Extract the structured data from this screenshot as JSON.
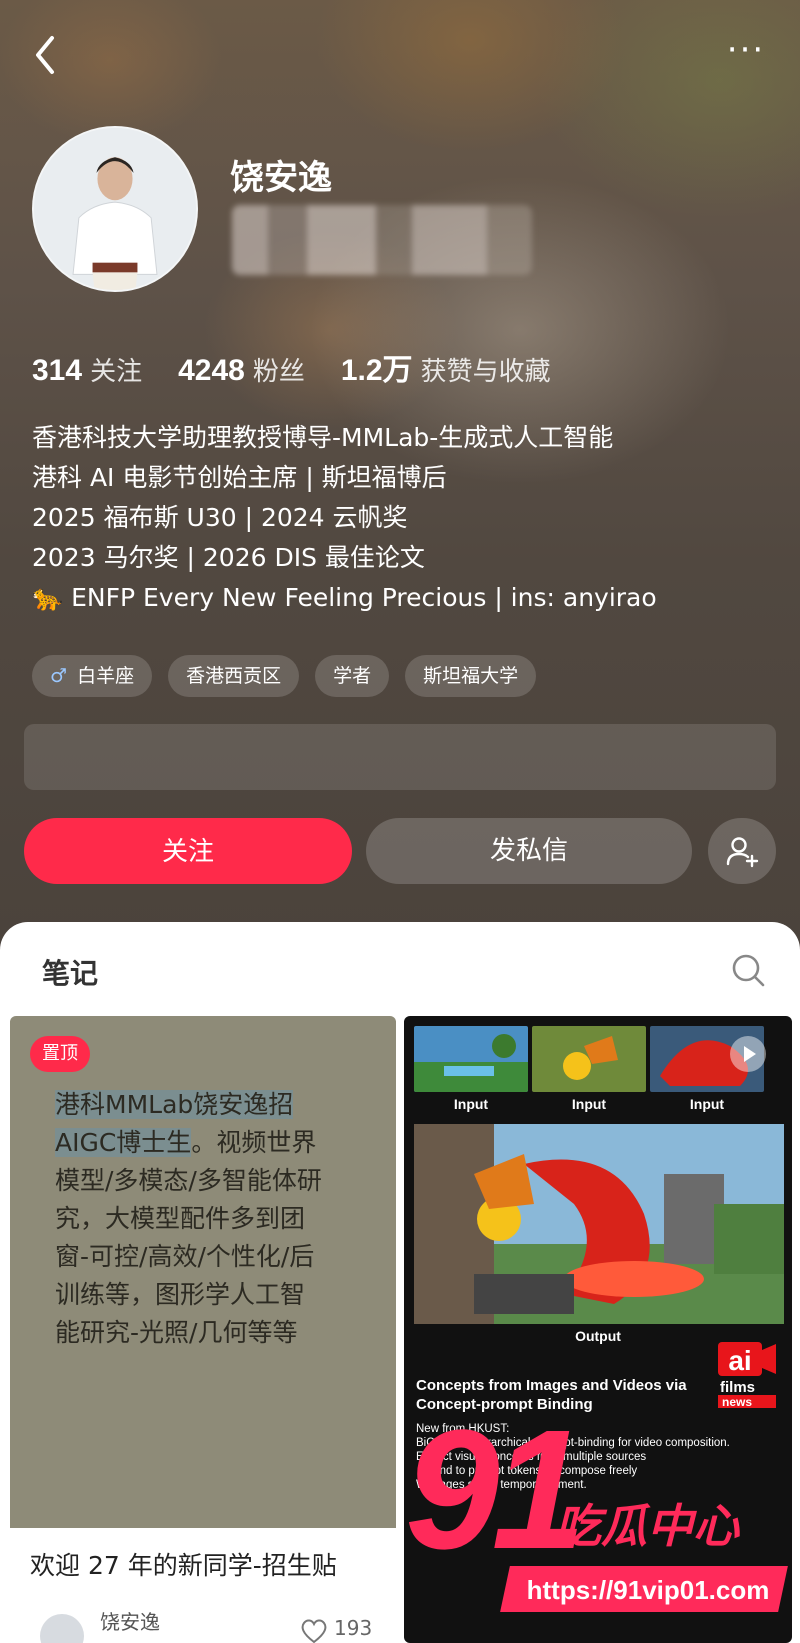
{
  "header": {
    "back_icon": "chevron-left-icon",
    "more_icon": "more-dots-icon",
    "more_label": "···"
  },
  "profile": {
    "name": "饶安逸",
    "stats": [
      {
        "value": "314",
        "label": "关注"
      },
      {
        "value": "4248",
        "label": "粉丝"
      },
      {
        "value": "1.2万",
        "label": "获赞与收藏"
      }
    ],
    "bio": [
      "香港科技大学助理教授博导-MMLab-生成式人工智能",
      "港科 AI 电影节创始主席 | 斯坦福博后",
      "2025 福布斯 U30 | 2024 云帆奖",
      "2023 马尔奖 | 2026 DIS 最佳论文",
      "🐆 ENFP Every New Feeling Precious | ins: anyirao"
    ],
    "tags": [
      {
        "icon": "♂",
        "label": "白羊座"
      },
      {
        "icon": "",
        "label": "香港西贡区"
      },
      {
        "icon": "",
        "label": "学者"
      },
      {
        "icon": "",
        "label": "斯坦福大学"
      }
    ]
  },
  "actions": {
    "follow_label": "关注",
    "message_label": "发私信",
    "add_friend_icon": "add-user-icon"
  },
  "colors": {
    "accent": "#ff2a4a",
    "hero_bg": "#5e5248",
    "card_bg": "#ffffff"
  },
  "notes_section": {
    "title": "笔记",
    "search_icon": "search-icon",
    "notes": [
      {
        "pinned_label": "置顶",
        "cover_text_highlight_1": "港科MMLab饶安逸",
        "cover_text_highlight_2": "招AIGC博士生",
        "cover_text_rest": "。视频世界模型/多模态/多智能体研究，大模型配件多到团窗-可控/高效/个性化/后训练等，图形学人工智能研究-光照/几何等等",
        "title": "欢迎 27 年的新同学-招生贴",
        "author": "饶安逸",
        "likes": "193"
      },
      {
        "input_labels": [
          "Input",
          "Input",
          "Input"
        ],
        "output_label": "Output",
        "paper_title": "Concepts from Images and Videos via Concept-prompt Binding",
        "paper_lines": [
          "New from HKUST:",
          "BiCo uses hierarchical concept-binding for video composition.",
          "Extract visual concepts from multiple sources",
          "→ bind to prompt tokens → compose freely",
          "W    mages     s with temporal,     ement."
        ],
        "logo_text": "ai films news"
      }
    ]
  },
  "watermark": {
    "big": "91",
    "text": "吃瓜中心",
    "url": "https://91vip01.com"
  }
}
